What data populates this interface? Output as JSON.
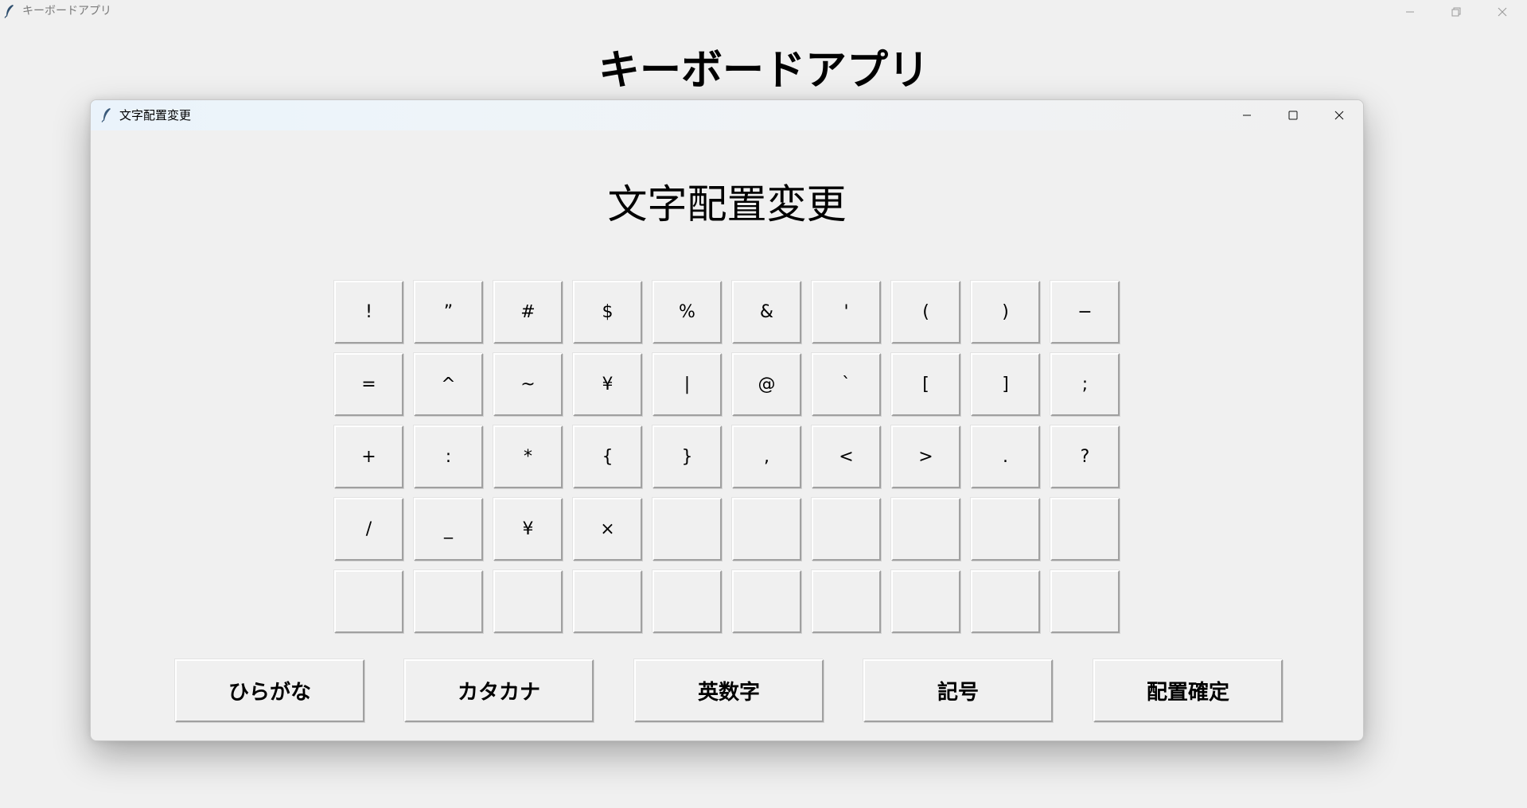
{
  "main_window": {
    "title": "キーボードアプリ",
    "heading": "キーボードアプリ",
    "controls": {
      "minimize_icon": "minimize-icon",
      "restore_icon": "restore-icon",
      "close_icon": "close-icon"
    }
  },
  "dialog": {
    "title": "文字配置変更",
    "heading": "文字配置変更",
    "keys": [
      [
        "!",
        "”",
        "#",
        "$",
        "%",
        "&",
        "'",
        "(",
        ")",
        "−"
      ],
      [
        "=",
        "^",
        "~",
        "¥",
        "|",
        "@",
        "`",
        "[",
        "]",
        ";"
      ],
      [
        "+",
        ":",
        "*",
        "{",
        "}",
        ",",
        "<",
        ">",
        ".",
        "?"
      ],
      [
        "/",
        "_",
        "¥",
        "×",
        "",
        "",
        "",
        "",
        "",
        ""
      ],
      [
        "",
        "",
        "",
        "",
        "",
        "",
        "",
        "",
        "",
        ""
      ]
    ],
    "buttons": {
      "hiragana": "ひらがな",
      "katakana": "カタカナ",
      "alphanumeric": "英数字",
      "symbols": "記号",
      "confirm": "配置確定"
    }
  }
}
